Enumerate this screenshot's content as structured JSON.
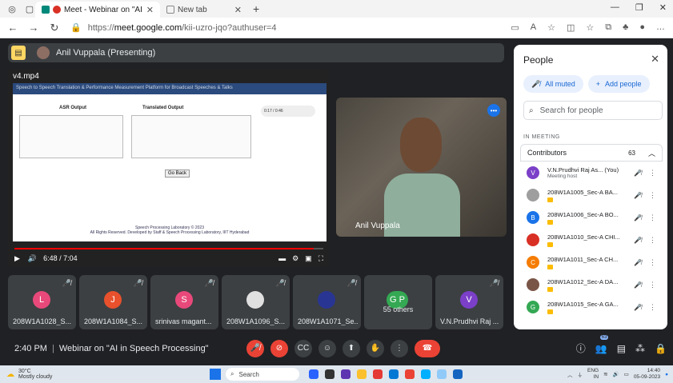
{
  "browser": {
    "tabs": [
      {
        "title": "Meet - Webinar on \"AI in Sp",
        "active": true
      },
      {
        "title": "New tab",
        "active": false
      }
    ],
    "url_prefix": "https://",
    "url_host": "meet.google.com",
    "url_path": "/kii-uzro-jqo?authuser=4"
  },
  "meet": {
    "presenter_label": "Anil Vuppala (Presenting)",
    "shared_screen": {
      "video_title": "v4.mp4",
      "page_header": "Speech to Speech Translation & Performance Measurement Platform for Broadcast Speeches & Talks",
      "asr_label": "ASR Output",
      "translated_label": "Translated Output",
      "audio_time": "0:17 / 0:46",
      "go_back": "Go Back",
      "footer1": "Speech Processing Laboratory © 2023",
      "footer2": "All Rights Reserved. Developed by Staff & Speech Processing Laboratory, IIIT Hyderabad",
      "time": "6:48 / 7:04",
      "progress": 0.97
    },
    "camera": {
      "name": "Anil Vuppala"
    },
    "tiles": [
      {
        "initial": "L",
        "color": "#e8497a",
        "label": "208W1A1028_S..."
      },
      {
        "initial": "J",
        "color": "#e8512c",
        "label": "208W1A1084_S..."
      },
      {
        "initial": "S",
        "color": "#e8497a",
        "label": "srinivas magant..."
      },
      {
        "initial": "",
        "color": "#e0e0e0",
        "label": "208W1A1096_S..."
      },
      {
        "initial": "",
        "color": "#283593",
        "label": "208W1A1071_Se..."
      },
      {
        "initial": "G P",
        "color": "#34a853",
        "label": "",
        "others": "55 others"
      },
      {
        "initial": "V",
        "color": "#7b3fc8",
        "label": "V.N.Prudhvi Raj ..."
      }
    ],
    "bottom": {
      "time": "2:40 PM",
      "meeting_title": "Webinar on \"AI in Speech Processing\"",
      "people_count": "63"
    }
  },
  "people_panel": {
    "title": "People",
    "all_muted": "All muted",
    "add_people": "Add people",
    "search_placeholder": "Search for people",
    "in_meeting": "IN MEETING",
    "contributors": "Contributors",
    "count": "63",
    "participants": [
      {
        "initial": "V",
        "color": "#7b3fc8",
        "name": "V.N.Prudhvi Raj As... (You)",
        "sub": "Meeting host"
      },
      {
        "initial": "",
        "color": "#9e9e9e",
        "name": "208W1A1005_Sec-A BA...",
        "sub": ""
      },
      {
        "initial": "B",
        "color": "#1a73e8",
        "name": "208W1A1006_Sec-A BO...",
        "sub": ""
      },
      {
        "initial": "",
        "color": "#d93025",
        "name": "208W1A1010_Sec-A CHI...",
        "sub": ""
      },
      {
        "initial": "C",
        "color": "#f57c00",
        "name": "208W1A1011_Sec-A CH...",
        "sub": ""
      },
      {
        "initial": "",
        "color": "#795548",
        "name": "208W1A1012_Sec-A DA...",
        "sub": ""
      },
      {
        "initial": "G",
        "color": "#34a853",
        "name": "208W1A1015_Sec-A GA...",
        "sub": ""
      }
    ]
  },
  "taskbar": {
    "temp": "30°C",
    "weather": "Mostly cloudy",
    "search": "Search",
    "lang1": "ENG",
    "lang2": "IN",
    "time": "14:40",
    "date": "05-09-2023"
  }
}
